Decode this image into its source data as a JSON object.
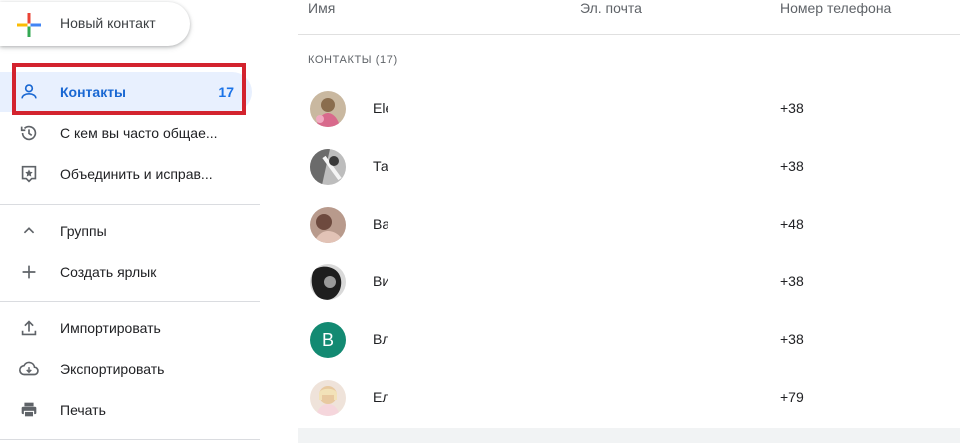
{
  "sidebar": {
    "new_contact_label": "Новый контакт",
    "items": [
      {
        "label": "Контакты",
        "count": "17",
        "icon": "person-icon"
      },
      {
        "label": "С кем вы часто общае...",
        "icon": "history-icon"
      },
      {
        "label": "Объединить и исправ...",
        "icon": "merge-fix-icon"
      },
      {
        "label": "Группы",
        "icon": "chevron-up-icon"
      },
      {
        "label": "Создать ярлык",
        "icon": "plus-icon"
      },
      {
        "label": "Импортировать",
        "icon": "upload-icon"
      },
      {
        "label": "Экспортировать",
        "icon": "cloud-download-icon"
      },
      {
        "label": "Печать",
        "icon": "printer-icon"
      }
    ]
  },
  "table": {
    "columns": {
      "name": "Имя",
      "email": "Эл. почта",
      "phone": "Номер телефона"
    },
    "section_label": "КОНТАКТЫ (17)",
    "rows": [
      {
        "name": "Ele",
        "phone": "+38",
        "avatar": "photo"
      },
      {
        "name": "Та",
        "phone": "+38",
        "avatar": "photo"
      },
      {
        "name": "Ва",
        "phone": "+48",
        "avatar": "photo"
      },
      {
        "name": "Ви",
        "phone": "+38",
        "avatar": "photo"
      },
      {
        "name": "Вл",
        "phone": "+38",
        "avatar": "letter",
        "letter": "В"
      },
      {
        "name": "Ел",
        "phone": "+79",
        "avatar": "photo"
      }
    ]
  },
  "colors": {
    "accent": "#1a73e8",
    "highlight_border": "#d3232e",
    "avatar_letter_bg": "#138a72"
  }
}
